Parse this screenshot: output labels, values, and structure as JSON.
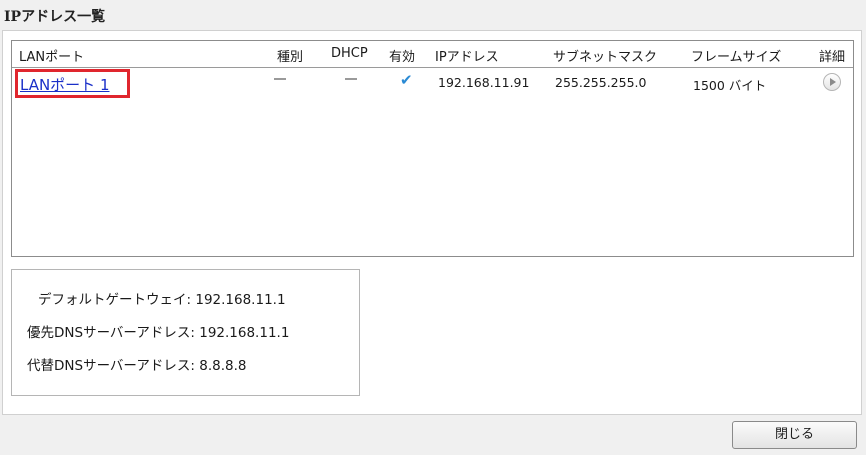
{
  "dialog": {
    "title": "IPアドレス一覧"
  },
  "table": {
    "headers": {
      "lan_port": "LANポート",
      "type": "種別",
      "dhcp": "DHCP",
      "enabled": "有効",
      "ip": "IPアドレス",
      "subnet": "サブネットマスク",
      "frame_size": "フレームサイズ",
      "detail": "詳細"
    },
    "rows": [
      {
        "lan_port": "LANポート 1",
        "type": "dash-icon",
        "dhcp": "dash-icon",
        "enabled": "check-icon",
        "ip": "192.168.11.91",
        "subnet": "255.255.255.0",
        "frame_size": "1500 バイト",
        "detail_icon": "play-circle-icon"
      }
    ]
  },
  "info": {
    "gateway_label": "デフォルトゲートウェイ:",
    "gateway_value": "192.168.11.1",
    "dns1_label": "優先DNSサーバーアドレス:",
    "dns1_value": "192.168.11.1",
    "dns2_label": "代替DNSサーバーアドレス:",
    "dns2_value": "8.8.8.8"
  },
  "footer": {
    "close_label": "閉じる"
  },
  "colors": {
    "link": "#1a2fc8",
    "highlight_border": "#e0262e",
    "check": "#2a8ad4"
  }
}
